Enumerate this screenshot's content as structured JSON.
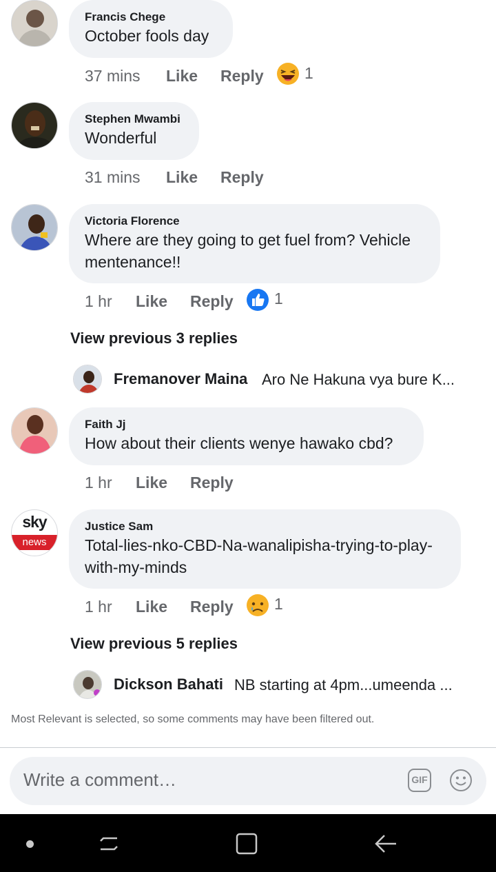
{
  "comments": [
    {
      "name": "Francis Chege",
      "text": "October fools day",
      "time": "37 mins",
      "like": "Like",
      "reply": "Reply",
      "reaction": "laugh-emoji",
      "reaction_count": "1"
    },
    {
      "name": "Stephen Mwambi",
      "text": "Wonderful",
      "time": "31 mins",
      "like": "Like",
      "reply": "Reply"
    },
    {
      "name": "Victoria Florence",
      "text": "Where are they going to get fuel from? Vehicle mentenance!!",
      "time": "1 hr",
      "like": "Like",
      "reply": "Reply",
      "reaction": "like-thumb",
      "reaction_count": "1",
      "view_previous": "View previous 3 replies",
      "latest_reply": {
        "name": "Fremanover Maina",
        "text": "Aro Ne Hakuna vya bure K..."
      }
    },
    {
      "name": "Faith Jj",
      "text": "How about their clients wenye hawako cbd?",
      "time": "1 hr",
      "like": "Like",
      "reply": "Reply"
    },
    {
      "name": "Justice Sam",
      "text": "Total-lies-nko-CBD-Na-wanalipisha-trying-to-play-with-my-minds",
      "time": "1 hr",
      "like": "Like",
      "reply": "Reply",
      "reaction": "sad-emoji",
      "reaction_count": "1",
      "view_previous": "View previous 5 replies",
      "latest_reply": {
        "name": "Dickson Bahati",
        "text": "NB starting at 4pm...umeenda ..."
      }
    }
  ],
  "sky_logo": {
    "top": "sky",
    "bottom": "news"
  },
  "notice": "Most Relevant is selected, so some comments may have been filtered out.",
  "composer": {
    "placeholder": "Write a comment…",
    "gif_label": "GIF"
  },
  "colors": {
    "bubble": "#f0f2f5",
    "meta": "#65676b",
    "like_blue": "#1877f2",
    "nav": "#000000"
  }
}
